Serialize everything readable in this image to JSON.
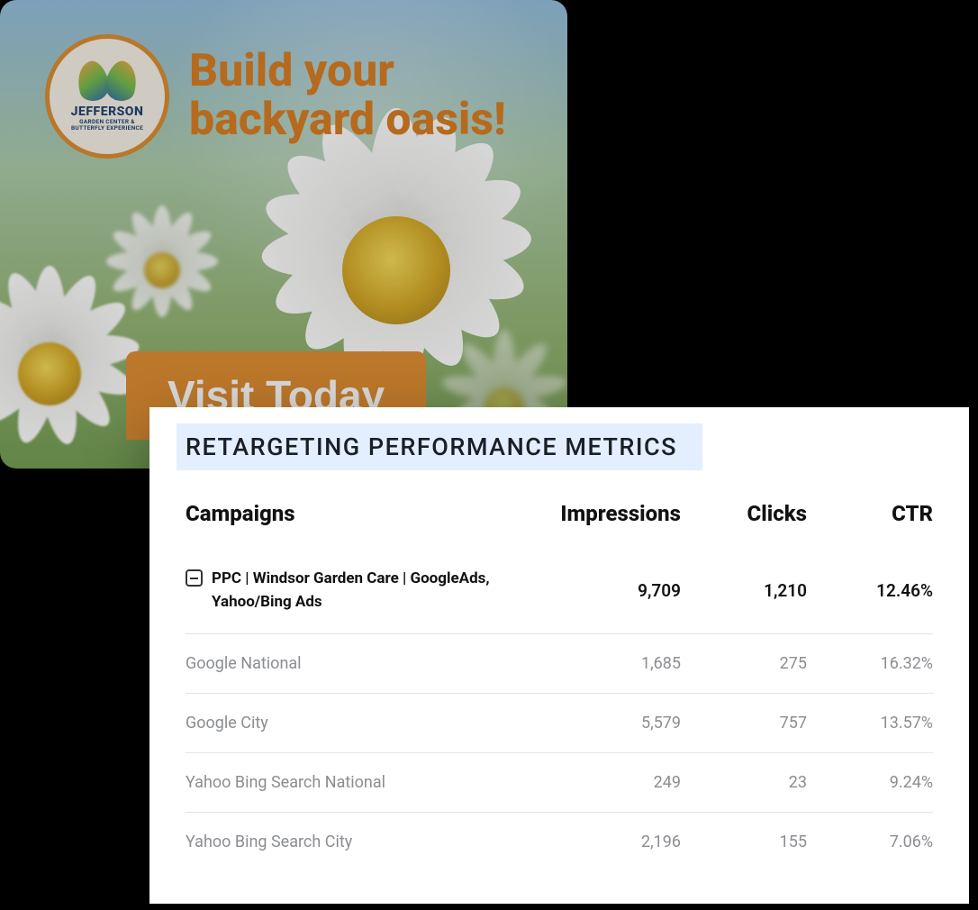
{
  "ad": {
    "logo_name": "JEFFERSON",
    "logo_sub": "GARDEN CENTER &\nBUTTERFLY EXPERIENCE",
    "headline": "Build your\nbackyard oasis!",
    "cta_label": "Visit Today"
  },
  "metrics": {
    "title": "RETARGETING PERFORMANCE METRICS",
    "columns": {
      "campaigns": "Campaigns",
      "impressions": "Impressions",
      "clicks": "Clicks",
      "ctr": "CTR"
    },
    "summary": {
      "label": "PPC  |  Windsor Garden Care  |  GoogleAds, Yahoo/Bing Ads",
      "impressions": "9,709",
      "clicks": "1,210",
      "ctr": "12.46%"
    },
    "rows": [
      {
        "name": "Google National",
        "impressions": "1,685",
        "clicks": "275",
        "ctr": "16.32%"
      },
      {
        "name": "Google City",
        "impressions": "5,579",
        "clicks": "757",
        "ctr": "13.57%"
      },
      {
        "name": "Yahoo Bing Search National",
        "impressions": "249",
        "clicks": "23",
        "ctr": "9.24%"
      },
      {
        "name": "Yahoo Bing Search City",
        "impressions": "2,196",
        "clicks": "155",
        "ctr": "7.06%"
      }
    ]
  },
  "chart_data": {
    "type": "table",
    "title": "RETARGETING PERFORMANCE METRICS",
    "columns": [
      "Campaigns",
      "Impressions",
      "Clicks",
      "CTR"
    ],
    "rows": [
      [
        "PPC | Windsor Garden Care | GoogleAds, Yahoo/Bing Ads",
        9709,
        1210,
        "12.46%"
      ],
      [
        "Google National",
        1685,
        275,
        "16.32%"
      ],
      [
        "Google City",
        5579,
        757,
        "13.57%"
      ],
      [
        "Yahoo Bing Search National",
        249,
        23,
        "9.24%"
      ],
      [
        "Yahoo Bing Search City",
        2196,
        155,
        "7.06%"
      ]
    ]
  }
}
